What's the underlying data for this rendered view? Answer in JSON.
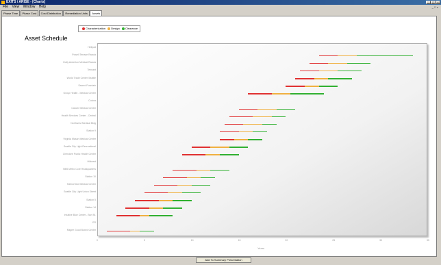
{
  "window": {
    "title": "EXITS / ARISE - [Charts]"
  },
  "menu": [
    "File",
    "View",
    "Window",
    "Help"
  ],
  "tabs": [
    "Phase Time",
    "Phase Cost",
    "Cost Distribution",
    "Remediation Units",
    "Assets"
  ],
  "chart_data": {
    "type": "gantt",
    "title": "Asset Schedule",
    "xlabel": "Years",
    "xlim": [
      0,
      35
    ],
    "xticks": [
      "0",
      "5",
      "10",
      "15",
      "20",
      "25",
      "30",
      "35"
    ],
    "legend": {
      "placement": "top",
      "items": [
        {
          "name": "Characterization",
          "color": "#e03030"
        },
        {
          "name": "Design",
          "color": "#f0b040"
        },
        {
          "name": "Clearance",
          "color": "#30b030"
        }
      ]
    },
    "assets": [
      {
        "name": "Helipad",
        "bars": []
      },
      {
        "name": "Powell Terrace Rancia",
        "bars": [
          23.5,
          25.5,
          27.5,
          33.5
        ]
      },
      {
        "name": "Dolly Anderton Medical Rancia",
        "bars": [
          22.5,
          24.5,
          26.5,
          29
        ]
      },
      {
        "name": "Tennant",
        "bars": [
          21.5,
          23.5,
          25.5,
          28
        ]
      },
      {
        "name": "World Trade Center Seattle",
        "bars": [
          21,
          23,
          24.5,
          27
        ]
      },
      {
        "name": "Sacred Fountain",
        "bars": [
          20,
          22,
          23.5,
          25.5
        ]
      },
      {
        "name": "Group Health - Medical Center",
        "bars": [
          16,
          18.5,
          20.5,
          24
        ]
      },
      {
        "name": "Cocina",
        "bars": []
      },
      {
        "name": "Cancer Medical Center",
        "bars": [
          15,
          17,
          19,
          21
        ]
      },
      {
        "name": "Health Services Center - Central",
        "bars": [
          14,
          16.5,
          18.5,
          20
        ]
      },
      {
        "name": "Northwest Medical Bldg",
        "bars": [
          13.5,
          15.5,
          17.5,
          19
        ]
      },
      {
        "name": "Station 9",
        "bars": [
          13,
          15,
          16.5,
          18
        ]
      },
      {
        "name": "Virginia Mason Medical Center",
        "bars": [
          13,
          14.5,
          16,
          17.5
        ]
      },
      {
        "name": "Seattle City Light Recreational",
        "bars": [
          10,
          12,
          14,
          16
        ]
      },
      {
        "name": "Cherokee Public Health Center",
        "bars": [
          9,
          11.5,
          13,
          15
        ]
      },
      {
        "name": "Hillcrest",
        "bars": []
      },
      {
        "name": "NBS Metro Core Headquarters",
        "bars": [
          8,
          10.5,
          12,
          14
        ]
      },
      {
        "name": "Station 10",
        "bars": [
          7,
          9.5,
          11,
          12.5
        ]
      },
      {
        "name": "Harborview Medical Center",
        "bars": [
          6,
          8.5,
          10,
          12
        ]
      },
      {
        "name": "Seattle City Light Union Street",
        "bars": [
          5,
          7.5,
          9,
          11
        ]
      },
      {
        "name": "Station 5",
        "bars": [
          4,
          6.5,
          8,
          10
        ]
      },
      {
        "name": "Station 14",
        "bars": [
          3,
          5.5,
          7,
          9
        ]
      },
      {
        "name": "Intuitive Blue Center - Burt St.",
        "bars": [
          2,
          4.5,
          5.5,
          8
        ]
      },
      {
        "name": "ER",
        "bars": []
      },
      {
        "name": "Ragee Good Boxed Center",
        "bars": [
          1,
          3.5,
          4.5,
          6
        ]
      }
    ]
  },
  "buttons": {
    "add_summary": "Add To Summary Presentation"
  }
}
